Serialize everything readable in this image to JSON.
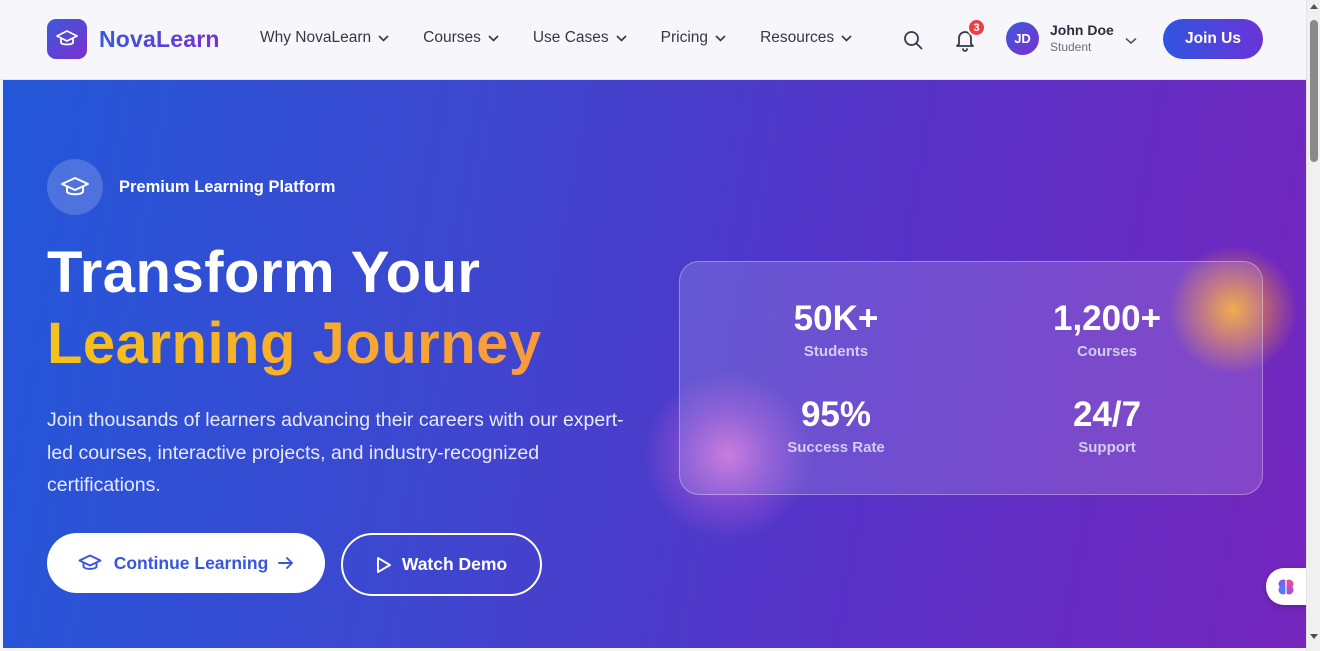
{
  "brand": {
    "name": "NovaLearn",
    "icon": "graduation-cap-icon"
  },
  "nav": {
    "items": [
      {
        "label": "Why NovaLearn"
      },
      {
        "label": "Courses"
      },
      {
        "label": "Use Cases"
      },
      {
        "label": "Pricing"
      },
      {
        "label": "Resources"
      }
    ]
  },
  "header": {
    "notification_count": "3",
    "user": {
      "initials": "JD",
      "name": "John Doe",
      "role": "Student"
    },
    "join_label": "Join Us"
  },
  "hero": {
    "badge_text": "Premium Learning Platform",
    "title_line1": "Transform Your",
    "title_line2": "Learning Journey",
    "description": "Join thousands of learners advancing their careers with our expert-led courses, interactive projects, and industry-recognized certifications.",
    "primary_cta": "Continue Learning",
    "secondary_cta": "Watch Demo"
  },
  "stats": [
    {
      "value": "50K+",
      "label": "Students"
    },
    {
      "value": "1,200+",
      "label": "Courses"
    },
    {
      "value": "95%",
      "label": "Success Rate"
    },
    {
      "value": "24/7",
      "label": "Support"
    }
  ],
  "colors": {
    "brand_gradient_start": "#2f55e0",
    "brand_gradient_end": "#6b34d8",
    "accent_yellow": "#f6c21a",
    "accent_orange": "#f79a3e",
    "badge_red": "#ef3e45"
  }
}
